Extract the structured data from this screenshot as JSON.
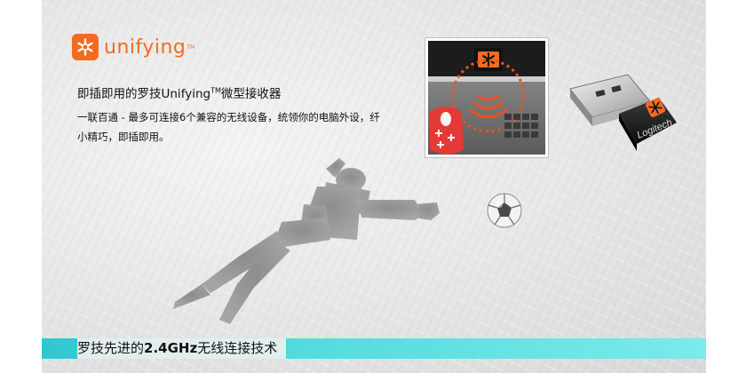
{
  "brand": {
    "logo_text": "unifying",
    "logo_tm": "TM",
    "logo_color": "#f26b21"
  },
  "headline": {
    "before": "即插即用的罗技Unifying",
    "sup": "TM",
    "after": "微型接收器"
  },
  "description": "一联百通 - 最多可连接6个兼容的无线设备，统领你的电脑外设，纤小精巧，即插即用。",
  "receiver": {
    "brand_label": "Logitech"
  },
  "bottom_banner": {
    "prefix": "罗技先进的",
    "highlight": "2.4GHz",
    "suffix": "无线连接技术",
    "bar_color": "#2fc7cf"
  },
  "icons": [
    "unifying-star-icon",
    "wifi-waves-icon",
    "usb-receiver-icon"
  ]
}
